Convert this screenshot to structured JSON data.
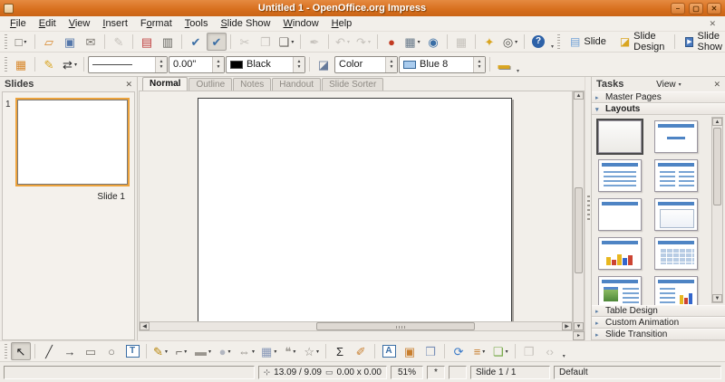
{
  "window": {
    "title": "Untitled 1 - OpenOffice.org Impress"
  },
  "titlebar": {
    "controls": [
      {
        "name": "minimize-button",
        "glyph": "–"
      },
      {
        "name": "maximize-button",
        "glyph": "▢"
      },
      {
        "name": "close-button",
        "glyph": "✕"
      }
    ]
  },
  "menubar": {
    "items": [
      {
        "name": "menu-file",
        "label": "File",
        "u": 0
      },
      {
        "name": "menu-edit",
        "label": "Edit",
        "u": 0
      },
      {
        "name": "menu-view",
        "label": "View",
        "u": 0
      },
      {
        "name": "menu-insert",
        "label": "Insert",
        "u": 0
      },
      {
        "name": "menu-format",
        "label": "Format",
        "u": 1
      },
      {
        "name": "menu-tools",
        "label": "Tools",
        "u": 0
      },
      {
        "name": "menu-slide-show",
        "label": "Slide Show",
        "u": 0
      },
      {
        "name": "menu-window",
        "label": "Window",
        "u": 0
      },
      {
        "name": "menu-help",
        "label": "Help",
        "u": 0
      }
    ],
    "close_document_glyph": "✕"
  },
  "toolbar_standard": {
    "items": [
      {
        "grip": true
      },
      {
        "name": "new-document-button",
        "glyph": "□",
        "color": "#6A6660",
        "dropdown": true
      },
      {
        "sep": true
      },
      {
        "name": "open-button",
        "glyph": "▱",
        "color": "#D8882C"
      },
      {
        "name": "save-button",
        "glyph": "▣",
        "color": "#5577AA"
      },
      {
        "name": "email-button",
        "glyph": "✉",
        "color": "#7A766F"
      },
      {
        "sep": true
      },
      {
        "name": "edit-file-button",
        "glyph": "✎",
        "disabled": true
      },
      {
        "sep": true
      },
      {
        "name": "export-pdf-button",
        "glyph": "▤",
        "color": "#C04040"
      },
      {
        "name": "print-button",
        "glyph": "▥",
        "color": "#666660"
      },
      {
        "sep": true
      },
      {
        "name": "spellcheck-button",
        "glyph": "✔",
        "color": "#3A6EA5"
      },
      {
        "name": "auto-spellcheck-button",
        "glyph": "✔",
        "color": "#3A6EA5",
        "pressed": true
      },
      {
        "sep": true
      },
      {
        "name": "cut-button",
        "glyph": "✂",
        "disabled": true
      },
      {
        "name": "copy-button",
        "glyph": "❐",
        "disabled": true
      },
      {
        "name": "paste-button",
        "glyph": "❑",
        "color": "#66625C",
        "dropdown": true
      },
      {
        "sep": true
      },
      {
        "name": "format-paintbrush-button",
        "glyph": "✒",
        "disabled": true
      },
      {
        "sep": true
      },
      {
        "name": "undo-button",
        "glyph": "↶",
        "disabled": true,
        "dropdown": true
      },
      {
        "name": "redo-button",
        "glyph": "↷",
        "disabled": true,
        "dropdown": true
      },
      {
        "sep": true
      },
      {
        "name": "insert-chart-button",
        "glyph": "●",
        "color": "#C23B22"
      },
      {
        "name": "insert-table-button",
        "glyph": "▦",
        "color": "#667788",
        "dropdown": true
      },
      {
        "name": "hyperlink-button",
        "glyph": "◉",
        "color": "#3A6EA5"
      },
      {
        "sep": true
      },
      {
        "name": "display-grid-button",
        "glyph": "▦",
        "disabled": true
      },
      {
        "sep": true
      },
      {
        "name": "navigator-button",
        "glyph": "✦",
        "color": "#D9A520"
      },
      {
        "name": "zoom-button",
        "glyph": "◎",
        "color": "#555550",
        "dropdown": true
      },
      {
        "sep": true
      },
      {
        "name": "help-button",
        "glyph": "?",
        "badge": true
      }
    ],
    "slide_label": "Slide",
    "slide_design_label": "Slide Design",
    "slide_show_label": "Slide Show"
  },
  "toolbar_line_filling": {
    "line_width_value": "0.00\"",
    "line_color_label": "Black",
    "line_color_hex": "#000000",
    "fill_type_label": "Color",
    "fill_color_label": "Blue 8",
    "fill_color_hex": "#AACCEE"
  },
  "slides_panel": {
    "title": "Slides",
    "close_glyph": "✕",
    "slides": [
      {
        "number": "1",
        "label": "Slide 1"
      }
    ]
  },
  "view_tabs": {
    "tabs": [
      {
        "name": "tab-normal",
        "label": "Normal",
        "active": true
      },
      {
        "name": "tab-outline",
        "label": "Outline"
      },
      {
        "name": "tab-notes",
        "label": "Notes"
      },
      {
        "name": "tab-handout",
        "label": "Handout"
      },
      {
        "name": "tab-slide-sorter",
        "label": "Slide Sorter"
      }
    ]
  },
  "tasks_panel": {
    "title": "Tasks",
    "view_label": "View",
    "close_glyph": "✕",
    "master_pages_label": "Master Pages",
    "layouts_label": "Layouts",
    "layouts": [
      {
        "name": "layout-blank",
        "kind": "blank",
        "selected": true
      },
      {
        "name": "layout-title-content",
        "kind": "title-line"
      },
      {
        "name": "layout-title-bullets",
        "kind": "title-bullets"
      },
      {
        "name": "layout-title-two-content",
        "kind": "title-2col"
      },
      {
        "name": "layout-title-only",
        "kind": "title-only"
      },
      {
        "name": "layout-centered-content",
        "kind": "title-box"
      },
      {
        "name": "layout-title-chart",
        "kind": "title-chart"
      },
      {
        "name": "layout-title-table",
        "kind": "title-table"
      },
      {
        "name": "layout-title-clipart-text",
        "kind": "title-clipart"
      },
      {
        "name": "layout-title-text-chart",
        "kind": "title-textchart"
      },
      {
        "name": "layout-row6-left",
        "kind": "title-line"
      },
      {
        "name": "layout-row6-right",
        "kind": "title-line"
      }
    ],
    "bottom_sections": [
      {
        "name": "section-table-design",
        "label": "Table Design"
      },
      {
        "name": "section-custom-animation",
        "label": "Custom Animation"
      },
      {
        "name": "section-slide-transition",
        "label": "Slide Transition"
      }
    ]
  },
  "drawing_toolbar": {
    "items": [
      {
        "grip": true
      },
      {
        "name": "select-tool",
        "glyph": "↖",
        "color": "#1A1A1A",
        "pressed": true
      },
      {
        "sep": true
      },
      {
        "name": "line-tool",
        "glyph": "╱",
        "color": "#3A3A3A"
      },
      {
        "name": "arrow-line-tool",
        "glyph": "→",
        "color": "#3A3A3A"
      },
      {
        "name": "rectangle-tool",
        "glyph": "▭",
        "color": "#76726C"
      },
      {
        "name": "ellipse-tool",
        "glyph": "○",
        "color": "#76726C"
      },
      {
        "name": "text-tool",
        "glyph": "T",
        "boxed": true
      },
      {
        "sep": true
      },
      {
        "name": "curve-tool",
        "glyph": "✎",
        "color": "#B8860B",
        "dropdown": true
      },
      {
        "name": "connector-tool",
        "glyph": "⌐",
        "color": "#66625C",
        "dropdown": true
      },
      {
        "name": "basic-shapes-tool",
        "glyph": "▬",
        "color": "#9A968F",
        "dropdown": true
      },
      {
        "name": "symbol-shapes-tool",
        "glyph": "●",
        "color": "#B2B6C0",
        "dropdown": true
      },
      {
        "name": "block-arrows-tool",
        "glyph": "⇔",
        "color": "#8A867F",
        "dropdown": true
      },
      {
        "name": "flowchart-tool",
        "glyph": "▦",
        "color": "#8898B8",
        "dropdown": true
      },
      {
        "name": "callouts-tool",
        "glyph": "❝",
        "color": "#9A968F",
        "dropdown": true
      },
      {
        "name": "stars-tool",
        "glyph": "☆",
        "color": "#8A867F",
        "dropdown": true
      },
      {
        "sep": true
      },
      {
        "name": "edit-points-button",
        "glyph": "Σ",
        "color": "#2A2A2A"
      },
      {
        "name": "glue-points-button",
        "glyph": "✐",
        "color": "#C87E2E"
      },
      {
        "sep": true
      },
      {
        "name": "fontwork-button",
        "glyph": "A",
        "boxed": true
      },
      {
        "name": "insert-picture-button",
        "glyph": "▣",
        "color": "#C87E2E"
      },
      {
        "name": "gallery-button",
        "glyph": "❒",
        "color": "#7A90B8"
      },
      {
        "sep": true
      },
      {
        "name": "rotate-button",
        "glyph": "⟳",
        "color": "#3A7AC8"
      },
      {
        "name": "alignment-button",
        "glyph": "≡",
        "color": "#C87E2E",
        "dropdown": true
      },
      {
        "name": "arrange-button",
        "glyph": "❏",
        "color": "#6BA33A",
        "dropdown": true
      },
      {
        "sep": true
      },
      {
        "name": "shadow-button",
        "glyph": "❐",
        "disabled": true
      },
      {
        "name": "extrusion-toggle-button",
        "glyph": "‹›",
        "disabled": true
      }
    ]
  },
  "status_bar": {
    "position": "13.09 / 9.09",
    "size": "0.00 x 0.00",
    "zoom": "51%",
    "modified_flag": "*",
    "slide_indicator": "Slide 1 / 1",
    "template_name": "Default"
  }
}
